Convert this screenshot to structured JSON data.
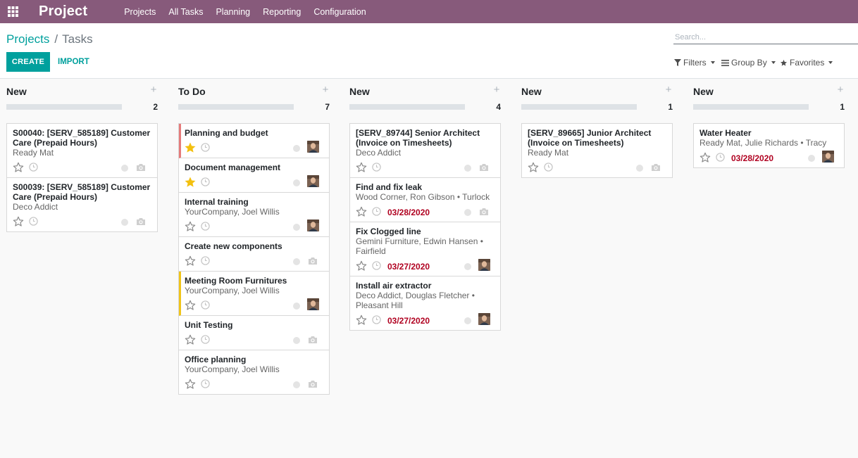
{
  "app_title": "Project",
  "menu": [
    "Projects",
    "All Tasks",
    "Planning",
    "Reporting",
    "Configuration"
  ],
  "breadcrumb": {
    "parent": "Projects",
    "current": "Tasks"
  },
  "buttons": {
    "create": "CREATE",
    "import": "IMPORT"
  },
  "search": {
    "placeholder": "Search..."
  },
  "search_options": {
    "filters": "Filters",
    "group_by": "Group By",
    "favorites": "Favorites"
  },
  "columns": [
    {
      "title": "New",
      "count": "2",
      "cards": [
        {
          "title": "S00040: [SERV_585189] Customer Care (Prepaid Hours)",
          "subtitle": "Ready Mat",
          "starred": false,
          "deadline": "",
          "assignee": false,
          "bar": ""
        },
        {
          "title": "S00039: [SERV_585189] Customer Care (Prepaid Hours)",
          "subtitle": "Deco Addict",
          "starred": false,
          "deadline": "",
          "assignee": false,
          "bar": ""
        }
      ]
    },
    {
      "title": "To Do",
      "count": "7",
      "cards": [
        {
          "title": "Planning and budget",
          "subtitle": "",
          "starred": true,
          "deadline": "",
          "assignee": true,
          "bar": "red"
        },
        {
          "title": "Document management",
          "subtitle": "",
          "starred": true,
          "deadline": "",
          "assignee": true,
          "bar": ""
        },
        {
          "title": "Internal training",
          "subtitle": "YourCompany, Joel Willis",
          "starred": false,
          "deadline": "",
          "assignee": true,
          "bar": ""
        },
        {
          "title": "Create new components",
          "subtitle": "",
          "starred": false,
          "deadline": "",
          "assignee": false,
          "bar": ""
        },
        {
          "title": "Meeting Room Furnitures",
          "subtitle": "YourCompany, Joel Willis",
          "starred": false,
          "deadline": "",
          "assignee": true,
          "bar": "yellow"
        },
        {
          "title": "Unit Testing",
          "subtitle": "",
          "starred": false,
          "deadline": "",
          "assignee": false,
          "bar": ""
        },
        {
          "title": "Office planning",
          "subtitle": "YourCompany, Joel Willis",
          "starred": false,
          "deadline": "",
          "assignee": false,
          "bar": ""
        }
      ]
    },
    {
      "title": "New",
      "count": "4",
      "cards": [
        {
          "title": "[SERV_89744] Senior Architect (Invoice on Timesheets)",
          "subtitle": "Deco Addict",
          "starred": false,
          "deadline": "",
          "assignee": false,
          "bar": ""
        },
        {
          "title": "Find and fix leak",
          "subtitle": "Wood Corner, Ron Gibson • Turlock",
          "starred": false,
          "deadline": "03/28/2020",
          "assignee": false,
          "bar": ""
        },
        {
          "title": "Fix Clogged line",
          "subtitle": "Gemini Furniture, Edwin Hansen • Fairfield",
          "starred": false,
          "deadline": "03/27/2020",
          "assignee": true,
          "bar": ""
        },
        {
          "title": "Install air extractor",
          "subtitle": "Deco Addict, Douglas Fletcher • Pleasant Hill",
          "starred": false,
          "deadline": "03/27/2020",
          "assignee": true,
          "bar": ""
        }
      ]
    },
    {
      "title": "New",
      "count": "1",
      "cards": [
        {
          "title": "[SERV_89665] Junior Architect (Invoice on Timesheets)",
          "subtitle": "Ready Mat",
          "starred": false,
          "deadline": "",
          "assignee": false,
          "bar": ""
        }
      ]
    },
    {
      "title": "New",
      "count": "1",
      "cards": [
        {
          "title": "Water Heater",
          "subtitle": "Ready Mat, Julie Richards • Tracy",
          "starred": false,
          "deadline": "03/28/2020",
          "assignee": true,
          "bar": ""
        }
      ]
    }
  ],
  "colors": {
    "navbar": "#875a7b",
    "accent": "#00a09d",
    "deadline": "#b00020",
    "star_on": "#f3c00f",
    "bar_red": "#e57b7b",
    "bar_yellow": "#f0c419"
  }
}
